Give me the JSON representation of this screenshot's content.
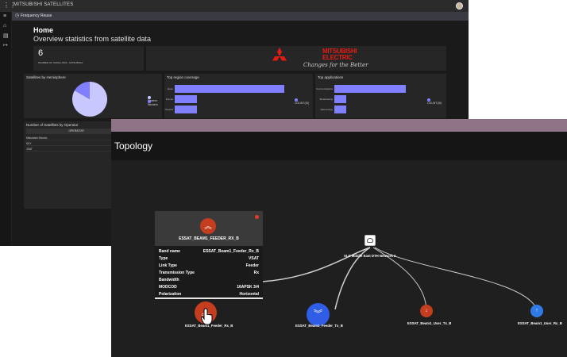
{
  "dashboard": {
    "app_title": "MITSUBISHI SATELLITES",
    "tab_label": "Frequency Reuse",
    "page_title": "Home",
    "page_subtitle": "Overview statistics from satellite data",
    "kpi": {
      "value": "6",
      "label": "NUMBER OF SATELLITES - MITSUBISHI"
    },
    "brand": {
      "line1": "MITSUBISHI",
      "line2": "ELECTRIC",
      "tagline": "Changes for the Better"
    },
    "hemisphere_tile": {
      "title": "Satellites by Hemisphere",
      "legend": [
        {
          "label": "Eastern",
          "color": "#c8c8ff"
        },
        {
          "label": "Western",
          "color": "#8080ff"
        }
      ]
    },
    "region_tile": {
      "title": "Top region coverage",
      "categories": [
        "Japan",
        "Europe",
        "Oceania"
      ],
      "legend_label": "COUNT(ID)"
    },
    "apps_tile": {
      "title": "Top applications",
      "categories": [
        "Communications",
        "Broadcasting",
        "Meteorology"
      ],
      "legend_label": "COUNT(ID)"
    },
    "operator_tile": {
      "title": "Number of Satellites by Operator",
      "column_header": "OPERATOR",
      "rows": [
        {
          "name": "Mitsubishi Electric",
          "value": "2"
        },
        {
          "name": "SKY",
          "value": "2"
        },
        {
          "name": "JSAT",
          "value": "1"
        }
      ]
    }
  },
  "chart_data": [
    {
      "type": "pie",
      "title": "Satellites by Hemisphere",
      "categories": [
        "Eastern",
        "Western"
      ],
      "values": [
        5,
        1
      ]
    },
    {
      "type": "bar",
      "title": "Top region coverage",
      "categories": [
        "Japan",
        "Europe",
        "Oceania"
      ],
      "series": [
        {
          "name": "COUNT(ID)",
          "values": [
            5,
            1,
            1
          ]
        }
      ]
    },
    {
      "type": "bar",
      "title": "Top applications",
      "categories": [
        "Communications",
        "Broadcasting",
        "Meteorology"
      ],
      "series": [
        {
          "name": "COUNT(ID)",
          "values": [
            6,
            1,
            1
          ]
        }
      ]
    }
  ],
  "topology": {
    "title": "Topology",
    "card": {
      "name": "ESSAT_BEAM1_FEEDER_RX_B",
      "properties": [
        {
          "key": "Band name",
          "value": "ESSAT_Beam1_Feeder_Rx_B"
        },
        {
          "key": "Type",
          "value": "VSAT"
        },
        {
          "key": "Link Type",
          "value": "Feeder"
        },
        {
          "key": "Transmission Type",
          "value": "Rx"
        },
        {
          "key": "Bandwidth",
          "value": ""
        },
        {
          "key": "MODCOD",
          "value": "16APSK 3/4"
        },
        {
          "key": "Polarization",
          "value": "Horizontal"
        }
      ]
    },
    "hub": {
      "label": "SLC Middle East DTH Network 2",
      "icon": "satellite-dish-icon"
    },
    "nodes": [
      {
        "label": "ESSAT_Beam1_Feeder_Rx_B",
        "icon": "double-chevron-up-icon",
        "color": "#c33d1e"
      },
      {
        "label": "ESSAT_Beam1_Feeder_Tx_B",
        "icon": "double-chevron-down-icon",
        "color": "#2f5de6"
      },
      {
        "label": "ESSAT_Beam1_User_Tx_B",
        "icon": "arrow-down-icon",
        "color": "#c33d1e"
      },
      {
        "label": "ESSAT_Beam1_User_Rx_B",
        "icon": "arrow-up-icon",
        "color": "#2f7be6"
      }
    ]
  }
}
